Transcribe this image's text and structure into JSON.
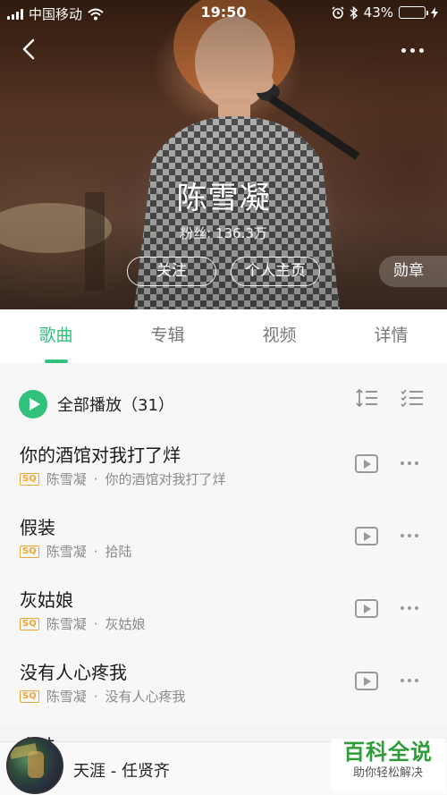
{
  "status_bar": {
    "carrier": "中国移动",
    "time": "19:50",
    "battery_percent": "43%",
    "battery_level": 0.43,
    "icons": [
      "signal-icon",
      "wifi-icon",
      "alarm-icon",
      "bluetooth-icon",
      "battery-icon",
      "charging-icon"
    ]
  },
  "header": {
    "artist_name": "陈雪凝",
    "fans": "粉丝: 136.3万",
    "follow_label": "关注",
    "homepage_label": "个人主页",
    "medal_label": "勋章"
  },
  "tabs": [
    {
      "label": "歌曲",
      "active": true
    },
    {
      "label": "专辑",
      "active": false
    },
    {
      "label": "视频",
      "active": false
    },
    {
      "label": "详情",
      "active": false
    }
  ],
  "play_all": {
    "label": "全部播放（31）"
  },
  "songs": [
    {
      "title": "你的酒馆对我打了烊",
      "quality": "SQ",
      "artist": "陈雪凝",
      "album": "你的酒馆对我打了烊"
    },
    {
      "title": "假装",
      "quality": "SQ",
      "artist": "陈雪凝",
      "album": "拾陆"
    },
    {
      "title": "灰姑娘",
      "quality": "SQ",
      "artist": "陈雪凝",
      "album": "灰姑娘"
    },
    {
      "title": "没有人心疼我",
      "quality": "SQ",
      "artist": "陈雪凝",
      "album": "没有人心疼我"
    }
  ],
  "partial_song_title": "白味",
  "separator": "·",
  "player": {
    "track": "天涯 - 任贤齐"
  },
  "watermark": {
    "line1": "百科全说",
    "line2": "助你轻松解决"
  },
  "colors": {
    "accent": "#31c27c",
    "sq_badge": "#f0a63a"
  }
}
